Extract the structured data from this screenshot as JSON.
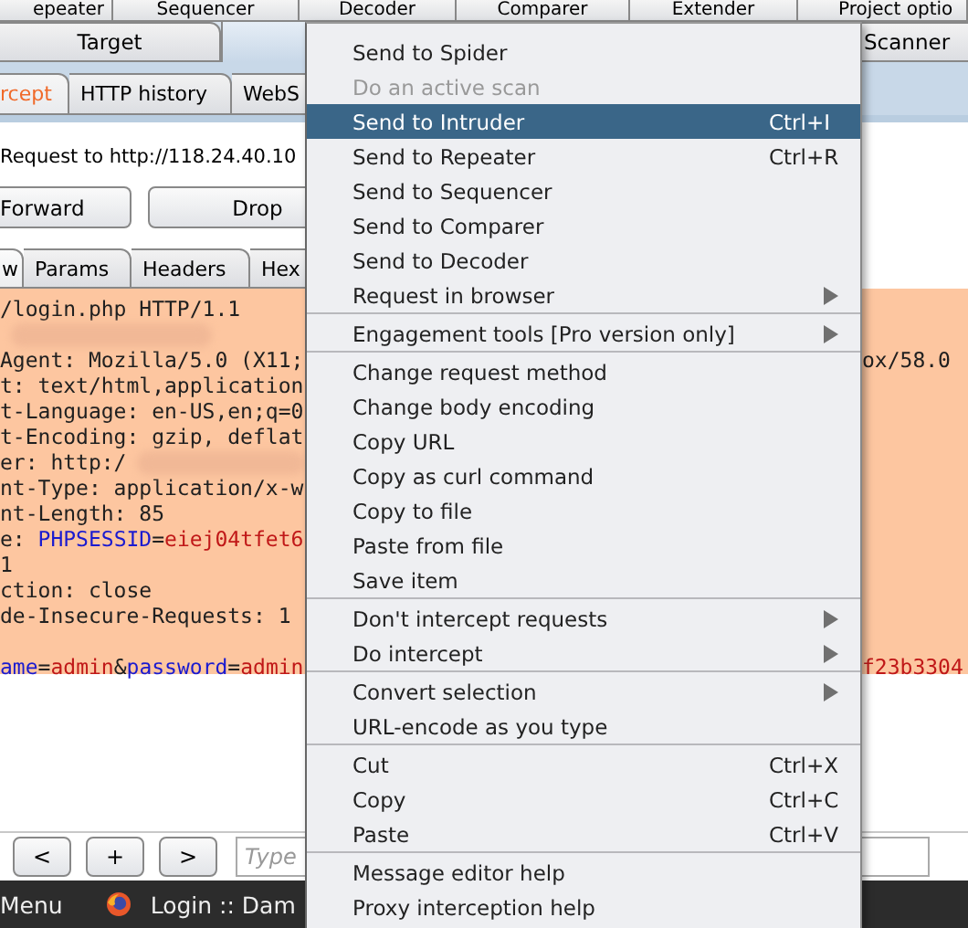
{
  "top_tabs": [
    {
      "label": "epeater",
      "selected": false
    },
    {
      "label": "Sequencer",
      "selected": false
    },
    {
      "label": "Decoder",
      "selected": false
    },
    {
      "label": "Comparer",
      "selected": false
    },
    {
      "label": "Extender",
      "selected": false
    },
    {
      "label": "Project optio",
      "selected": false
    }
  ],
  "tabs": [
    {
      "label": "Target",
      "selected": false
    },
    {
      "selected": true
    },
    {
      "label": "Scanner",
      "selected": false
    }
  ],
  "sub_tabs": [
    {
      "label": "rcept",
      "selected": true
    },
    {
      "label": "HTTP history",
      "selected": false
    },
    {
      "label": "WebS",
      "selected": false
    }
  ],
  "request_label": "Request to http://118.24.40.10",
  "buttons": [
    "Forward",
    "Drop"
  ],
  "editor_tabs": [
    {
      "label": "w",
      "selected": true
    },
    {
      "label": "Params",
      "selected": false
    },
    {
      "label": "Headers",
      "selected": false
    },
    {
      "label": "Hex",
      "selected": false
    }
  ],
  "editor_lines": [
    {
      "segments": [
        {
          "kind": "plain",
          "text": "/login.php HTTP/1.1"
        }
      ]
    },
    {
      "segments": [
        {
          "kind": "blur"
        }
      ]
    },
    {
      "segments": [
        {
          "kind": "plain",
          "text": "Agent: Mozilla/5.0 (X11;"
        }
      ],
      "tail": {
        "kind": "plain",
        "text": "ox/58.0"
      }
    },
    {
      "segments": [
        {
          "kind": "plain",
          "text": "t: text/html,application"
        }
      ]
    },
    {
      "segments": [
        {
          "kind": "plain",
          "text": "t-Language: en-US,en;q=0"
        }
      ]
    },
    {
      "segments": [
        {
          "kind": "plain",
          "text": "t-Encoding: gzip, deflat"
        }
      ]
    },
    {
      "segments": [
        {
          "kind": "plain",
          "text": "er: http:/"
        },
        {
          "kind": "blur"
        }
      ]
    },
    {
      "segments": [
        {
          "kind": "plain",
          "text": "nt-Type: application/x-w"
        }
      ]
    },
    {
      "segments": [
        {
          "kind": "plain",
          "text": "nt-Length: 85"
        }
      ]
    },
    {
      "segments": [
        {
          "kind": "plain",
          "text": "e: "
        },
        {
          "kind": "name",
          "text": "PHPSESSID"
        },
        {
          "kind": "plain",
          "text": "="
        },
        {
          "kind": "value",
          "text": "eiej04tfet6"
        }
      ]
    },
    {
      "segments": [
        {
          "kind": "plain",
          "text": "1"
        }
      ]
    },
    {
      "segments": [
        {
          "kind": "plain",
          "text": "ction: close"
        }
      ]
    },
    {
      "segments": [
        {
          "kind": "plain",
          "text": "de-Insecure-Requests: 1"
        }
      ]
    }
  ],
  "editor_body": [
    {
      "segments": [
        {
          "kind": "name",
          "text": "ame"
        },
        {
          "kind": "plain",
          "text": "="
        },
        {
          "kind": "value",
          "text": "admin"
        },
        {
          "kind": "plain",
          "text": "&"
        },
        {
          "kind": "name",
          "text": "password"
        },
        {
          "kind": "plain",
          "text": "="
        },
        {
          "kind": "value",
          "text": "admin"
        }
      ],
      "tail": {
        "kind": "value",
        "text": "f23b3304"
      }
    }
  ],
  "nav_buttons": [
    "<",
    "+",
    ">"
  ],
  "search": {
    "placeholder": "Type"
  },
  "taskbar": {
    "menu": "Menu",
    "window": "Login :: Dam"
  },
  "context_menu": {
    "groups": [
      [
        {
          "label": "Send to Spider",
          "disabled": false,
          "selected": false,
          "submenu": false
        },
        {
          "label": "Do an active scan",
          "disabled": true,
          "selected": false,
          "submenu": false
        },
        {
          "label": "Send to Intruder",
          "shortcut": "Ctrl+I",
          "disabled": false,
          "selected": true,
          "submenu": false
        },
        {
          "label": "Send to Repeater",
          "shortcut": "Ctrl+R",
          "disabled": false,
          "selected": false,
          "submenu": false
        },
        {
          "label": "Send to Sequencer",
          "disabled": false,
          "selected": false,
          "submenu": false
        },
        {
          "label": "Send to Comparer",
          "disabled": false,
          "selected": false,
          "submenu": false
        },
        {
          "label": "Send to Decoder",
          "disabled": false,
          "selected": false,
          "submenu": false
        },
        {
          "label": "Request in browser",
          "disabled": false,
          "selected": false,
          "submenu": true
        }
      ],
      [
        {
          "label": "Engagement tools [Pro version only]",
          "disabled": false,
          "selected": false,
          "submenu": true
        }
      ],
      [
        {
          "label": "Change request method",
          "disabled": false,
          "selected": false,
          "submenu": false
        },
        {
          "label": "Change body encoding",
          "disabled": false,
          "selected": false,
          "submenu": false
        },
        {
          "label": "Copy URL",
          "disabled": false,
          "selected": false,
          "submenu": false
        },
        {
          "label": "Copy as curl command",
          "disabled": false,
          "selected": false,
          "submenu": false
        },
        {
          "label": "Copy to file",
          "disabled": false,
          "selected": false,
          "submenu": false
        },
        {
          "label": "Paste from file",
          "disabled": false,
          "selected": false,
          "submenu": false
        },
        {
          "label": "Save item",
          "disabled": false,
          "selected": false,
          "submenu": false
        }
      ],
      [
        {
          "label": "Don't intercept requests",
          "disabled": false,
          "selected": false,
          "submenu": true
        },
        {
          "label": "Do intercept",
          "disabled": false,
          "selected": false,
          "submenu": true
        }
      ],
      [
        {
          "label": "Convert selection",
          "disabled": false,
          "selected": false,
          "submenu": true
        },
        {
          "label": "URL-encode as you type",
          "disabled": false,
          "selected": false,
          "submenu": false
        }
      ],
      [
        {
          "label": "Cut",
          "shortcut": "Ctrl+X",
          "disabled": false,
          "selected": false,
          "submenu": false
        },
        {
          "label": "Copy",
          "shortcut": "Ctrl+C",
          "disabled": false,
          "selected": false,
          "submenu": false
        },
        {
          "label": "Paste",
          "shortcut": "Ctrl+V",
          "disabled": false,
          "selected": false,
          "submenu": false
        }
      ],
      [
        {
          "label": "Message editor help",
          "disabled": false,
          "selected": false,
          "submenu": false
        },
        {
          "label": "Proxy interception help",
          "disabled": false,
          "selected": false,
          "submenu": false
        }
      ]
    ]
  }
}
